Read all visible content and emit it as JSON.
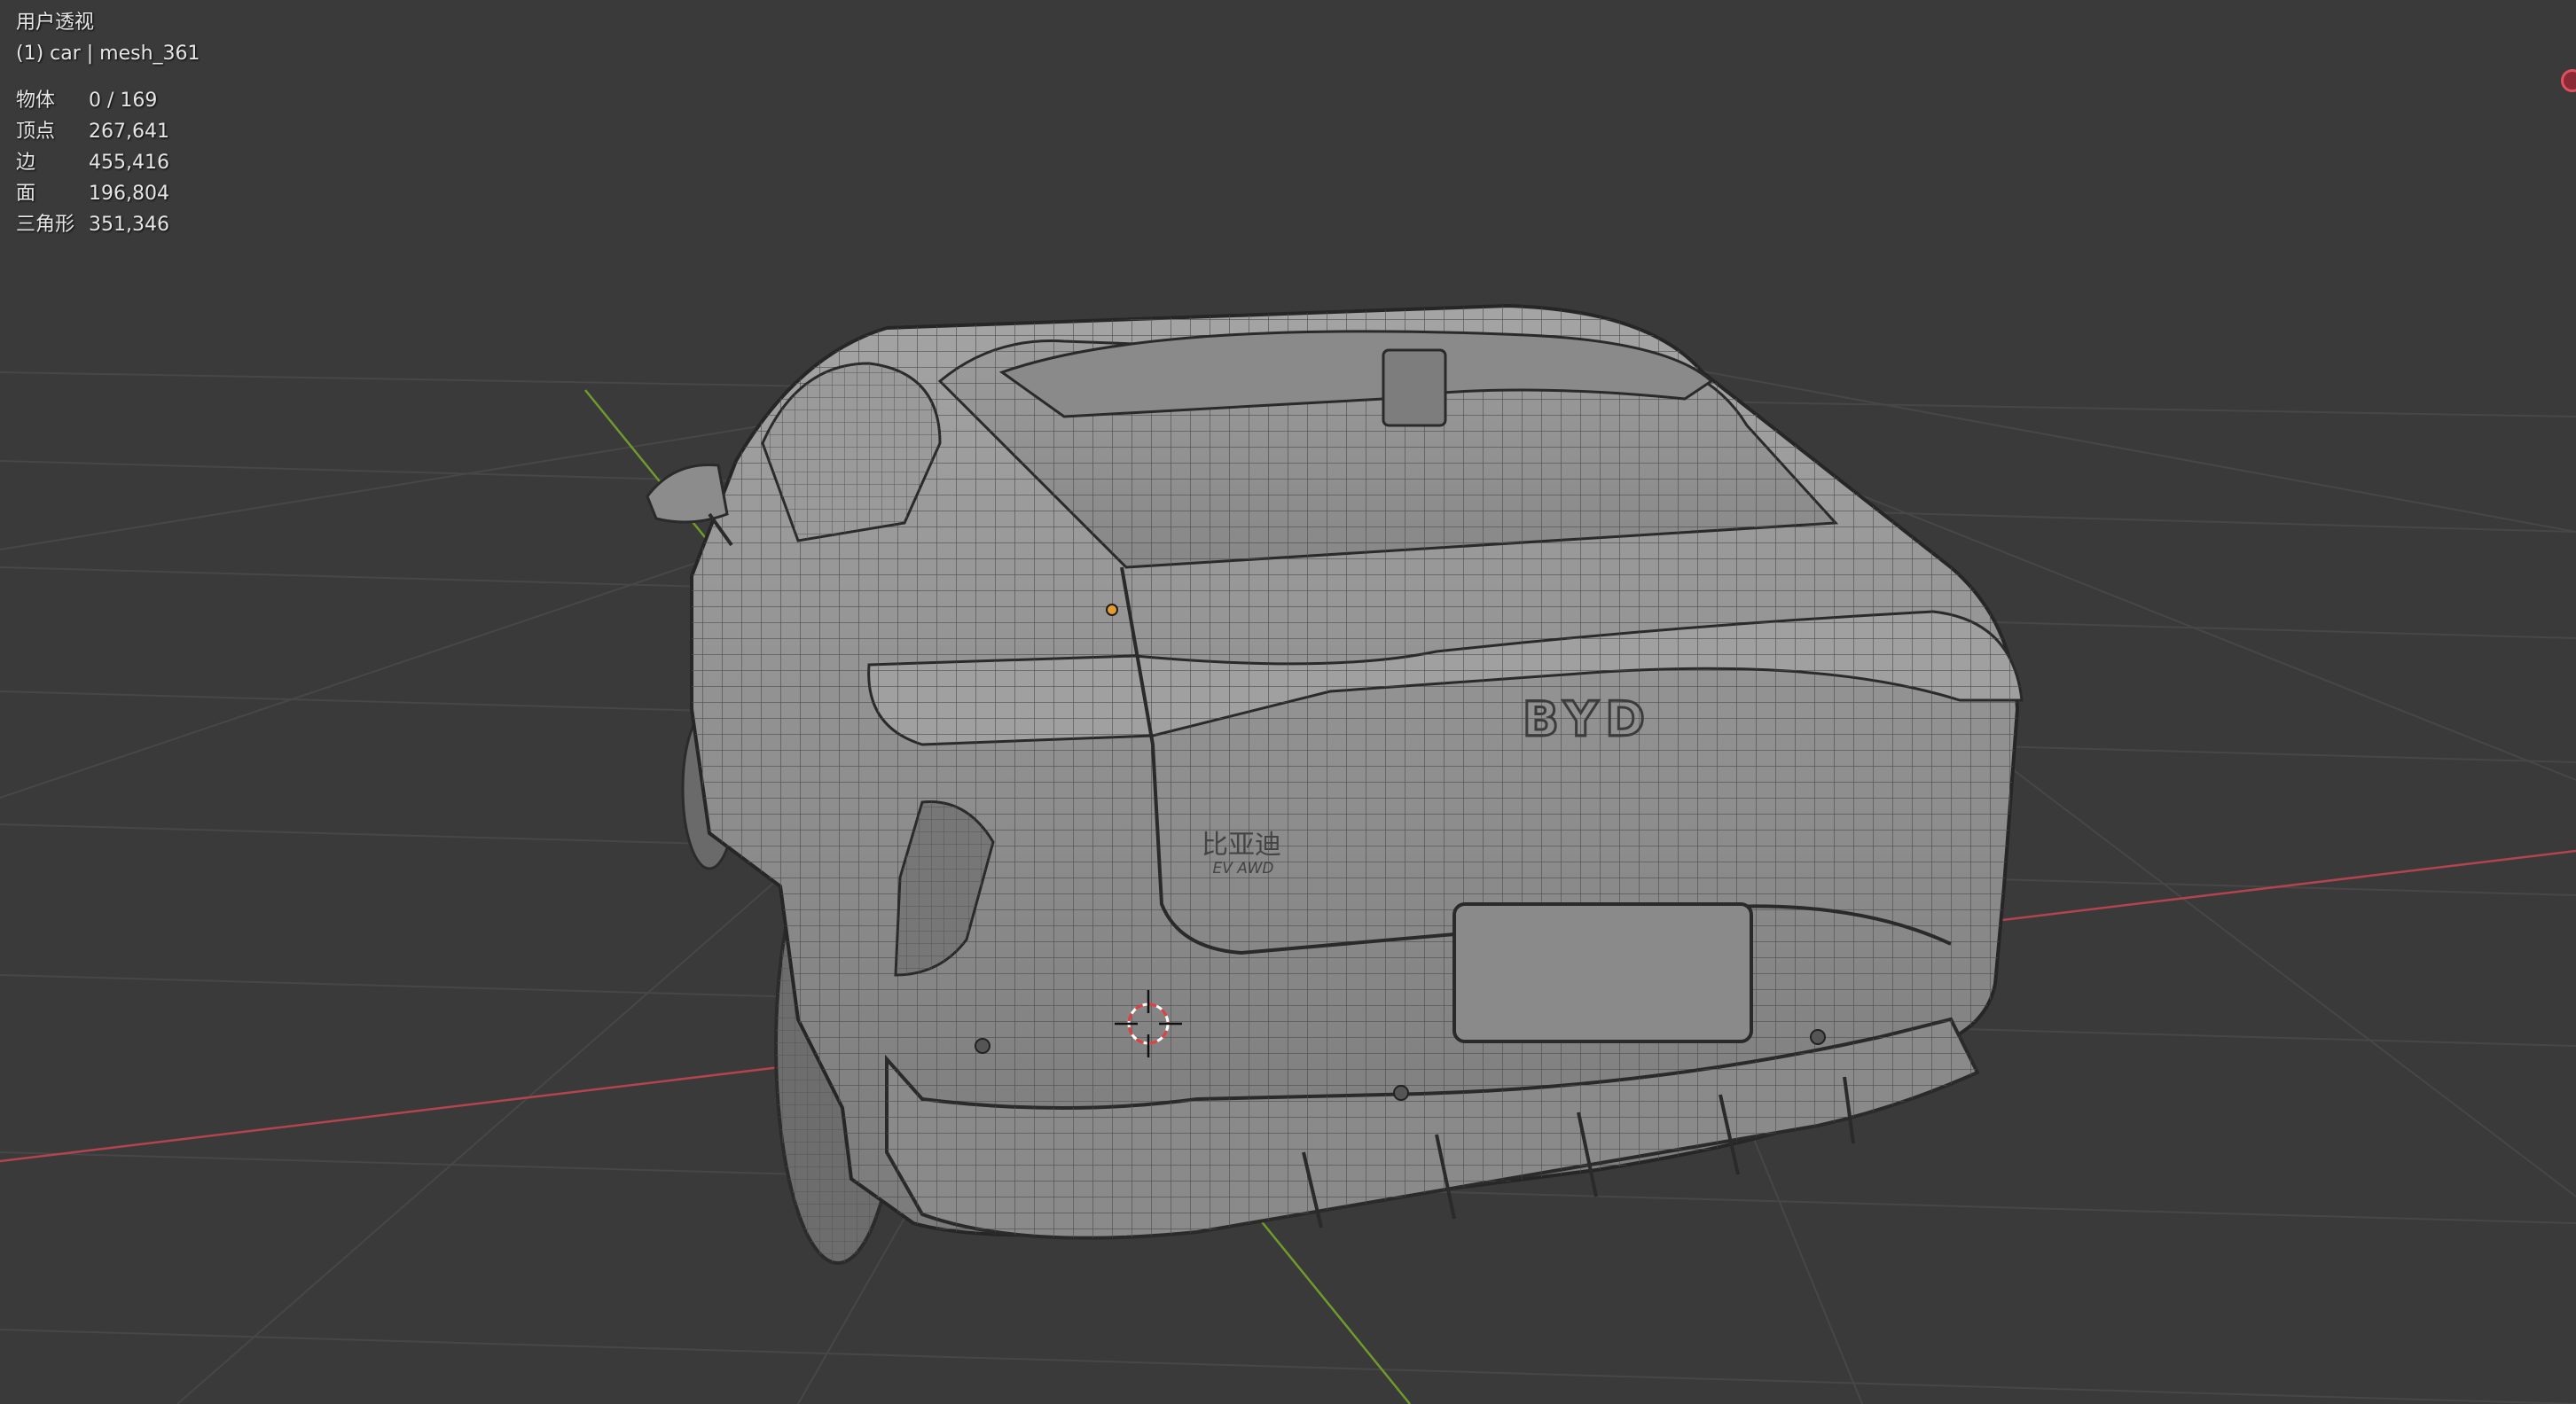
{
  "viewport": {
    "view_name": "用户透视",
    "object_info": "(1) car | mesh_361",
    "background_color": "#3a3a3a",
    "grid_color": "#4a4a4a",
    "x_axis_color": "#b3444f",
    "y_axis_color": "#6f9a2c"
  },
  "stats": [
    {
      "label": "物体",
      "value": "0 / 169"
    },
    {
      "label": "顶点",
      "value": "267,641"
    },
    {
      "label": "边",
      "value": "455,416"
    },
    {
      "label": "面",
      "value": "196,804"
    },
    {
      "label": "三角形",
      "value": "351,346"
    }
  ],
  "car": {
    "badge_logo": "BYD",
    "badge_cn": "比亚迪",
    "badge_model": "EV AWD",
    "body_color": "#8e8e8e",
    "wire_color": "#5a5a5a"
  }
}
